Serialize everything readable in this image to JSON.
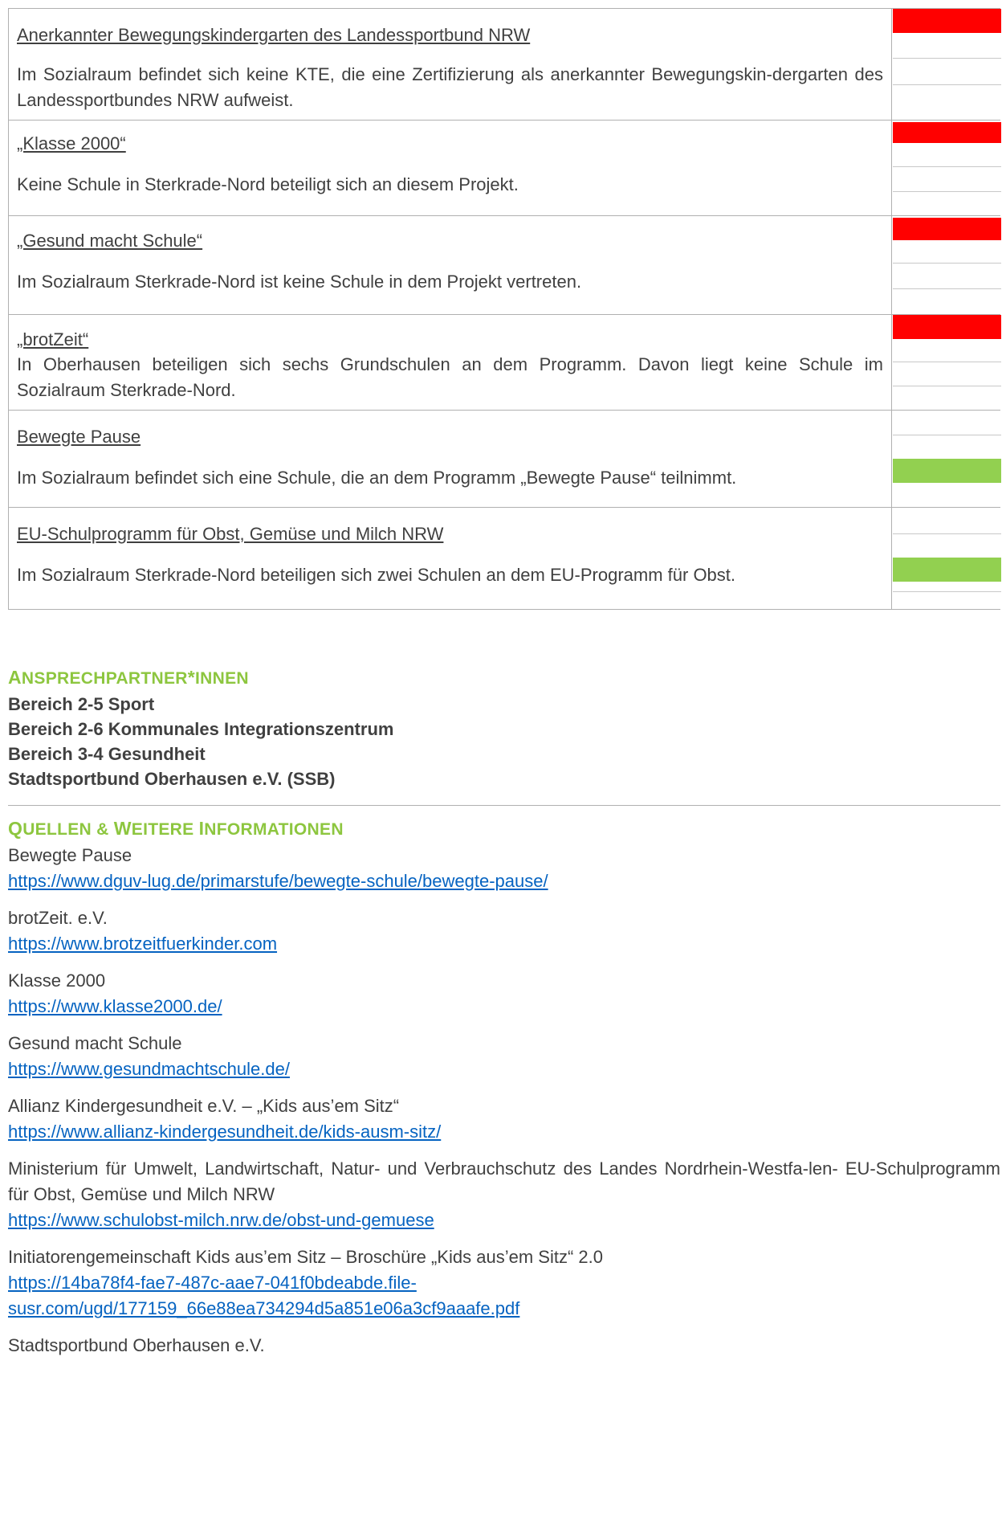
{
  "rows": [
    {
      "title": "Anerkannter Bewegungskindergarten des Landessportbund NRW",
      "description": "Im Sozialraum befindet sich keine KTE, die eine Zertifizierung als anerkannter Bewegungskin-dergarten des Landessportbundes NRW aufweist.",
      "indicator": "red"
    },
    {
      "title": "„Klasse 2000“",
      "description": "Keine Schule in Sterkrade-Nord beteiligt sich an diesem Projekt.",
      "indicator": "red"
    },
    {
      "title": "„Gesund macht Schule“",
      "description": "Im Sozialraum Sterkrade-Nord ist keine Schule in dem Projekt vertreten.",
      "indicator": "red"
    },
    {
      "title": "„brotZeit“",
      "description": "In Oberhausen beteiligen sich sechs Grundschulen an dem Programm. Davon liegt keine Schule im Sozialraum Sterkrade-Nord.",
      "indicator": "red"
    },
    {
      "title": "Bewegte Pause",
      "description": "Im Sozialraum befindet sich eine Schule, die an dem Programm „Bewegte Pause“ teilnimmt.",
      "indicator": "green"
    },
    {
      "title": "EU-Schulprogramm für Obst, Gemüse und Milch NRW",
      "description": "Im Sozialraum Sterkrade-Nord beteiligen sich zwei Schulen an dem EU-Programm für Obst.",
      "indicator": "green"
    }
  ],
  "colors": {
    "red": "#ff0000",
    "green": "#92d050",
    "heading": "#8dc63f",
    "link": "#0563c1"
  },
  "contacts": {
    "heading_first": "A",
    "heading_rest": "nsprechpartner",
    "heading_star": "*",
    "heading_end": "innen",
    "items": [
      "Bereich 2-5 Sport",
      "Bereich 2-6 Kommunales Integrationszentrum",
      "Bereich 3-4 Gesundheit",
      "Stadtsportbund Oberhausen e.V. (SSB)"
    ]
  },
  "sources": {
    "heading_q": "Q",
    "heading_q_rest": "uellen & ",
    "heading_w": "W",
    "heading_w_rest": "eitere ",
    "heading_i": "I",
    "heading_i_rest": "nformationen",
    "items": [
      {
        "title": "Bewegte Pause",
        "links": [
          "https://www.dguv-lug.de/primarstufe/bewegte-schule/bewegte-pause/"
        ]
      },
      {
        "title": "brotZeit. e.V.",
        "links": [
          "https://www.brotzeitfuerkinder.com"
        ]
      },
      {
        "title": "Klasse 2000",
        "links": [
          "https://www.klasse2000.de/"
        ]
      },
      {
        "title": "Gesund macht Schule",
        "links": [
          "https://www.gesundmachtschule.de/"
        ]
      },
      {
        "title": "Allianz Kindergesundheit e.V. – „Kids aus’em Sitz“",
        "links": [
          "https://www.allianz-kindergesundheit.de/kids-ausm-sitz/"
        ]
      },
      {
        "title": "Ministerium für Umwelt, Landwirtschaft, Natur- und Verbrauchschutz des Landes Nordrhein-Westfa-len- EU-Schulprogramm für Obst, Gemüse und Milch NRW",
        "links": [
          "https://www.schulobst-milch.nrw.de/obst-und-gemuese"
        ]
      },
      {
        "title": "Initiatorengemeinschaft Kids aus’em Sitz – Broschüre „Kids aus’em Sitz“ 2.0",
        "links": [
          "https://14ba78f4-fae7-487c-aae7-041f0bdeabde.file-",
          "susr.com/ugd/177159_66e88ea734294d5a851e06a3cf9aaafe.pdf"
        ]
      },
      {
        "title": "Stadtsportbund Oberhausen e.V.",
        "links": []
      }
    ]
  }
}
